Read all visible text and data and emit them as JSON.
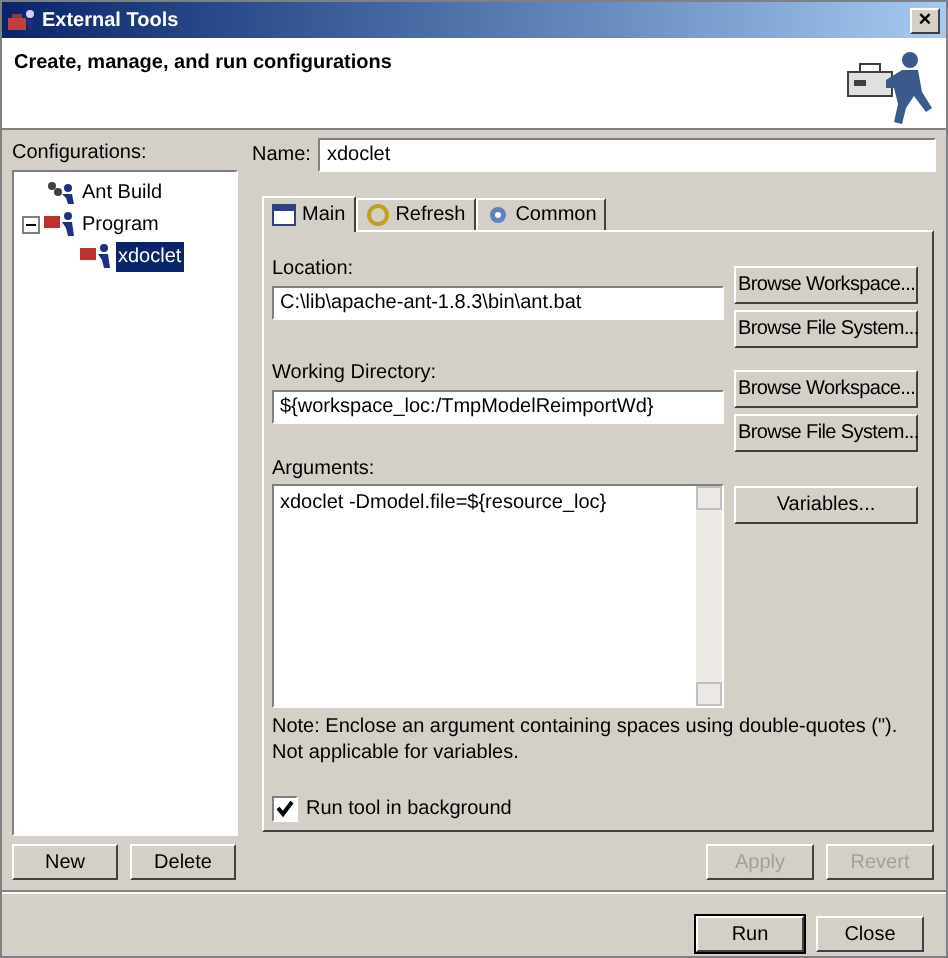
{
  "window": {
    "title": "External Tools",
    "close": "×"
  },
  "header": {
    "title": "Create, manage, and run configurations"
  },
  "configurations": {
    "label": "Configurations:",
    "tree": [
      {
        "label": "Ant Build",
        "kind": "ant",
        "selected": false
      },
      {
        "label": "Program",
        "kind": "program",
        "expanded": true,
        "selected": false,
        "children": [
          {
            "label": "xdoclet",
            "kind": "program",
            "selected": true
          }
        ]
      }
    ]
  },
  "left_buttons": [
    {
      "label": "New",
      "disabled": false
    },
    {
      "label": "Delete",
      "disabled": false
    }
  ],
  "name": {
    "label": "Name:",
    "value": "xdoclet"
  },
  "tabs": [
    {
      "label": "Main",
      "selected": true
    },
    {
      "label": "Refresh",
      "selected": false
    },
    {
      "label": "Common",
      "selected": false
    }
  ],
  "location": {
    "label": "Location:",
    "value": "C:\\lib\\apache-ant-1.8.3\\bin\\ant.bat",
    "buttons": [
      "Browse Workspace...",
      "Browse File System..."
    ]
  },
  "working_directory": {
    "label": "Working Directory:",
    "value": "${workspace_loc:/TmpModelReimportWd}",
    "buttons": [
      "Browse Workspace...",
      "Browse File System..."
    ]
  },
  "arguments": {
    "label": "Arguments:",
    "value": "xdoclet -Dmodel.file=${resource_loc}",
    "button": "Variables..."
  },
  "note": [
    "Note: Enclose an argument containing spaces using double-quotes (\").",
    "Not applicable for variables."
  ],
  "run_in_background": {
    "label": "Run tool in background",
    "checked": true
  },
  "apply_buttons": [
    {
      "label": "Apply",
      "disabled": true
    },
    {
      "label": "Revert",
      "disabled": true
    }
  ],
  "dialog_buttons": [
    {
      "label": "Run",
      "default": true
    },
    {
      "label": "Close",
      "default": false
    }
  ]
}
